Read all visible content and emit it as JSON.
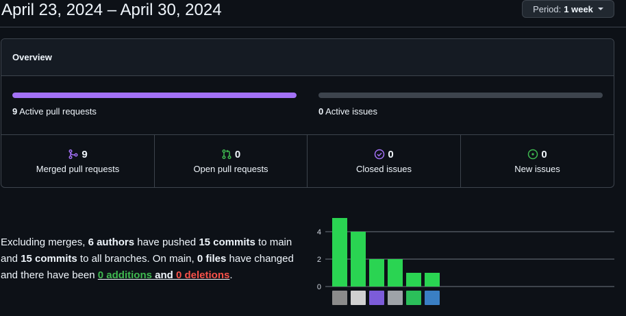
{
  "header": {
    "date_range": "April 23, 2024 – April 30, 2024",
    "period_prefix": "Period:",
    "period_value": "1 week"
  },
  "overview": {
    "title": "Overview",
    "pull_requests": {
      "count": "9",
      "label": "Active pull requests",
      "fill_fraction": 1.0,
      "color": "#a371f7"
    },
    "issues": {
      "count": "0",
      "label": "Active issues",
      "fill_fraction": 0.0,
      "color": "#3d444d"
    },
    "stats": [
      {
        "value": "9",
        "label": "Merged pull requests",
        "icon": "merged-pr-icon",
        "color": "#a371f7"
      },
      {
        "value": "0",
        "label": "Open pull requests",
        "icon": "open-pr-icon",
        "color": "#3fb950"
      },
      {
        "value": "0",
        "label": "Closed issues",
        "icon": "closed-issue-icon",
        "color": "#a371f7"
      },
      {
        "value": "0",
        "label": "New issues",
        "icon": "new-issue-icon",
        "color": "#3fb950"
      }
    ]
  },
  "summary": {
    "t1": "Excluding merges, ",
    "authors": "6 authors",
    "t2": " have pushed ",
    "commits_main": "15 commits",
    "t3": " to main and ",
    "commits_all": "15 commits",
    "t4": " to all branches. On main, ",
    "files": "0 files",
    "t5": " have changed and there have been ",
    "additions": "0 additions",
    "t6": " and ",
    "deletions": "0 deletions",
    "t7": "."
  },
  "chart_data": {
    "type": "bar",
    "categories": [
      "author-1",
      "author-2",
      "author-3",
      "author-4",
      "author-5",
      "author-6"
    ],
    "values": [
      5,
      4,
      2,
      2,
      1,
      1
    ],
    "y_ticks": [
      "0",
      "2",
      "4"
    ],
    "ylim": [
      0,
      5
    ],
    "grid": true,
    "bar_color": "#2ad452"
  }
}
